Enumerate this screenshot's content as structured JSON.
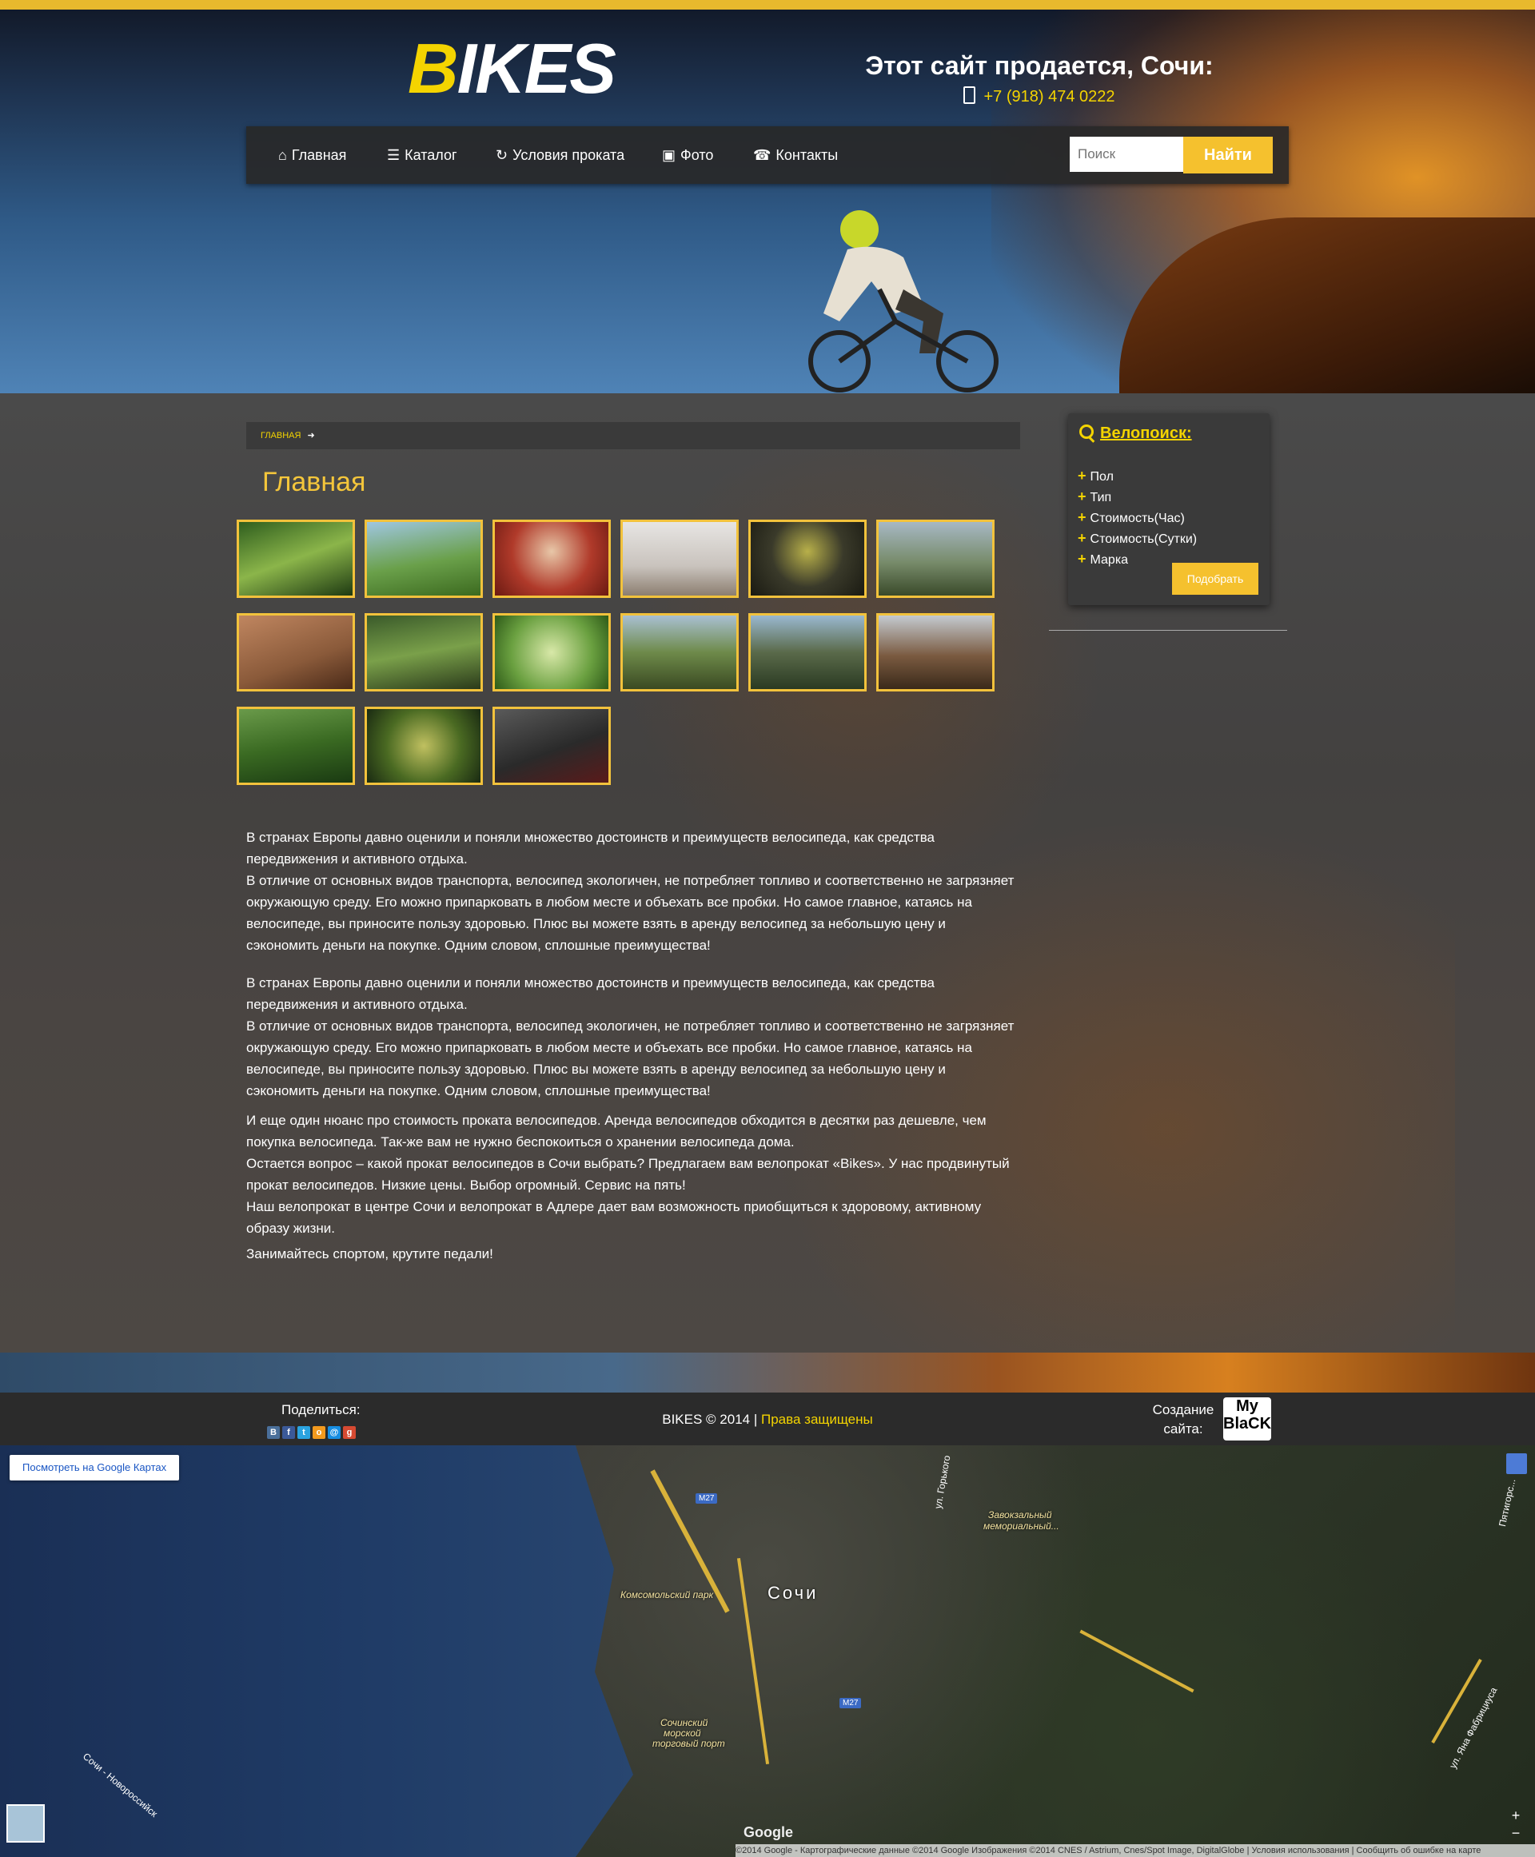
{
  "brand": {
    "logo_first": "B",
    "logo_rest": "IKES",
    "accent_color": "#f4d400",
    "button_color": "#f5c12e"
  },
  "header": {
    "sale_title": "Этот сайт продается, Сочи:",
    "phone": "+7 (918) 474 0222"
  },
  "nav": {
    "items": [
      {
        "label": "Главная",
        "icon": "home-icon"
      },
      {
        "label": "Каталог",
        "icon": "list-icon"
      },
      {
        "label": "Условия проката",
        "icon": "refresh-icon"
      },
      {
        "label": "Фото",
        "icon": "picture-icon"
      },
      {
        "label": "Контакты",
        "icon": "phone-icon"
      }
    ],
    "search_placeholder": "Поиск",
    "search_button": "Найти"
  },
  "breadcrumb": {
    "home": "ГЛАВНАЯ"
  },
  "page_title": "Главная",
  "gallery": {
    "count": 15
  },
  "content": {
    "block1": [
      "В странах Европы давно оценили и поняли множество достоинств и преимуществ велосипеда, как средства передвижения и активного отдыха.",
      "В отличие от основных видов транспорта, велосипед экологичен, не потребляет топливо и соответственно не загрязняет окружающую среду. Его можно припарковать в любом месте и объехать все пробки. Но самое главное, катаясь на велосипеде, вы приносите пользу здоровью. Плюс вы можете взять в аренду велосипед за небольшую цену и сэкономить деньги на покупке. Одним словом, сплошные преимущества!"
    ],
    "block2": [
      "В странах Европы давно оценили и поняли множество достоинств и преимуществ велосипеда, как средства передвижения и активного отдыха.",
      "В отличие от основных видов транспорта, велосипед экологичен, не потребляет топливо и соответственно не загрязняет окружающую среду. Его можно припарковать в любом месте и объехать все пробки. Но самое главное, катаясь на велосипеде, вы приносите пользу здоровью. Плюс вы можете взять в аренду велосипед за небольшую цену и сэкономить деньги на покупке. Одним словом, сплошные преимущества!"
    ],
    "block3": [
      "И еще один нюанс про стоимость проката велосипедов. Аренда велосипедов обходится в десятки раз дешевле, чем покупка велосипеда. Так-же вам не нужно беспокоиться о хранении велосипеда дома.",
      "Остается вопрос – какой прокат велосипедов в Сочи выбрать? Предлагаем вам велопрокат «Bikes». У нас продвинутый прокат велосипедов. Низкие цены. Выбор огромный. Сервис на пять!",
      "Наш велопрокат в центре Сочи и велопрокат в Адлере дает вам возможность приобщиться к здоровому, активному образу жизни."
    ],
    "closing": "Занимайтесь спортом, крутите педали!"
  },
  "sidebar": {
    "title": "Велопоиск:",
    "filters": [
      "Пол",
      "Тип",
      "Стоимость(Час)",
      "Стоимость(Сутки)",
      "Марка"
    ],
    "button": "Подобрать"
  },
  "footer": {
    "share_label": "Поделиться:",
    "share_icons": [
      "vk-icon",
      "facebook-icon",
      "twitter-icon",
      "odnoklassniki-icon",
      "mailru-icon",
      "googleplus-icon"
    ],
    "copyright": "BIKES © 2014 |",
    "rights": "Права защищены",
    "creator_line1": "Создание",
    "creator_line2": "сайта:",
    "creator_logo_line1": "My",
    "creator_logo_line2": "BlaCK"
  },
  "map": {
    "open_button": "Посмотреть на Google Картах",
    "city": "Сочи",
    "labels": {
      "park": "Комсомольский парк",
      "memorial_1": "Завокзальный",
      "memorial_2": "мемориальный...",
      "port_1": "Сочинский",
      "port_2": "морской",
      "port_3": "торговый порт",
      "street_gorky": "ул. Горького",
      "street_pyatigorskaya": "Пятигорс...",
      "street_fabritsiusa": "ул. Яна Фабрициуса",
      "sea_road": "Сочи - Новороссийск",
      "m27_a": "M27",
      "m27_b": "M27"
    },
    "credits": "©2014 Google - Картографические данные ©2014 Google Изображения ©2014 CNES / Astrium, Cnes/Spot Image, DigitalGlobe  |  Условия использования  |  Сообщить об ошибке на карте",
    "google": "Google"
  }
}
